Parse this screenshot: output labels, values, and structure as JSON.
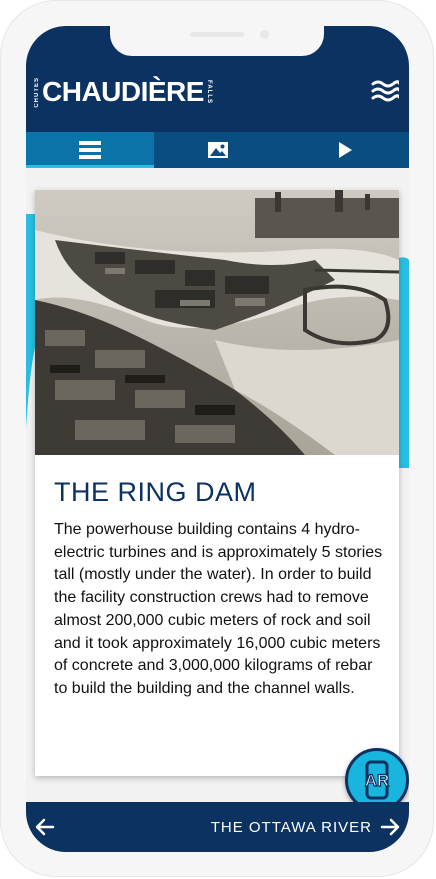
{
  "header": {
    "logo_main": "CHAUDIÈRE",
    "logo_left": "CHUTES",
    "logo_right": "FALLS",
    "menu_icon": "wave-menu-icon"
  },
  "tabs": [
    {
      "icon": "list-icon",
      "active": true
    },
    {
      "icon": "image-icon",
      "active": false
    },
    {
      "icon": "play-icon",
      "active": false
    }
  ],
  "article": {
    "title": "THE RING DAM",
    "body": "The powerhouse building contains 4 hydro-electric turbines and is approximately 5 stories tall (mostly under the water). In order to build the facility construction crews had to remove almost 200,000 cubic meters of rock and soil and it took approximately 16,000 cubic meters of concrete and 3,000,000 kilograms of rebar to build the building and the channel walls."
  },
  "ar_button": {
    "label": "AR"
  },
  "footer": {
    "next_label": "THE OTTAWA RIVER"
  },
  "colors": {
    "navy": "#0b3261",
    "tab_bar": "#0a4d80",
    "tab_active": "#0a74a8",
    "accent": "#1ab5de"
  }
}
